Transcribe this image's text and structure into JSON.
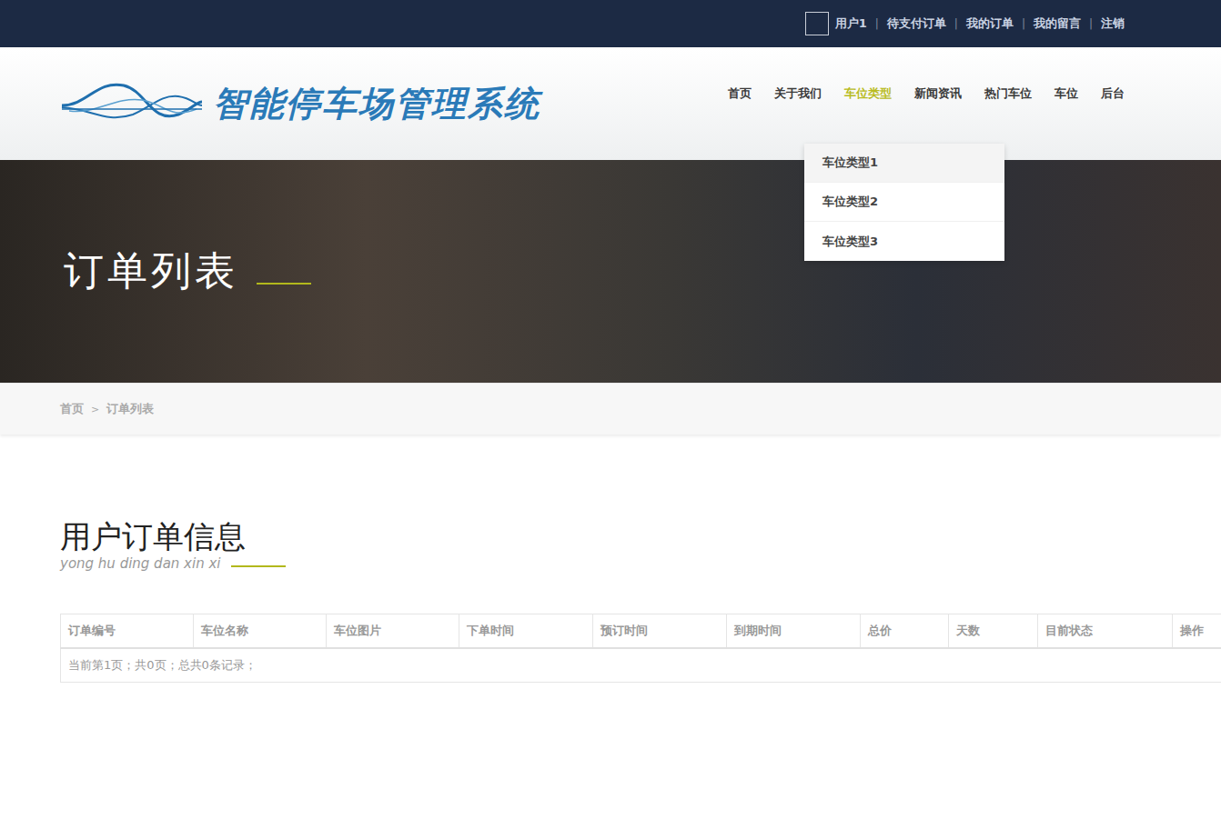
{
  "topbar": {
    "user": "用户1",
    "separator": "|",
    "links": [
      "待支付订单",
      "我的订单",
      "我的留言",
      "注销"
    ]
  },
  "logo": {
    "text": "智能停车场管理系统"
  },
  "nav": [
    {
      "label": "首页",
      "selected": false
    },
    {
      "label": "关于我们",
      "selected": false
    },
    {
      "label": "车位类型",
      "selected": true
    },
    {
      "label": "新闻资讯",
      "selected": false
    },
    {
      "label": "热门车位",
      "selected": false
    },
    {
      "label": "车位",
      "selected": false
    },
    {
      "label": "后台",
      "selected": false
    }
  ],
  "dropdown": [
    {
      "label": "车位类型1",
      "hovered": true
    },
    {
      "label": "车位类型2",
      "hovered": false
    },
    {
      "label": "车位类型3",
      "hovered": false
    }
  ],
  "banner": {
    "title": "订单列表"
  },
  "breadcrumb": {
    "items": [
      "首页",
      "订单列表"
    ],
    "separator": ">"
  },
  "section": {
    "title": "用户订单信息",
    "subtitle": "yong hu ding dan xin xi"
  },
  "table": {
    "columns": [
      "订单编号",
      "车位名称",
      "车位图片",
      "下单时间",
      "预订时间",
      "到期时间",
      "总价",
      "天数",
      "目前状态",
      "操作"
    ],
    "rows": [],
    "footer": "当前第1页；共0页；总共0条记录；"
  }
}
